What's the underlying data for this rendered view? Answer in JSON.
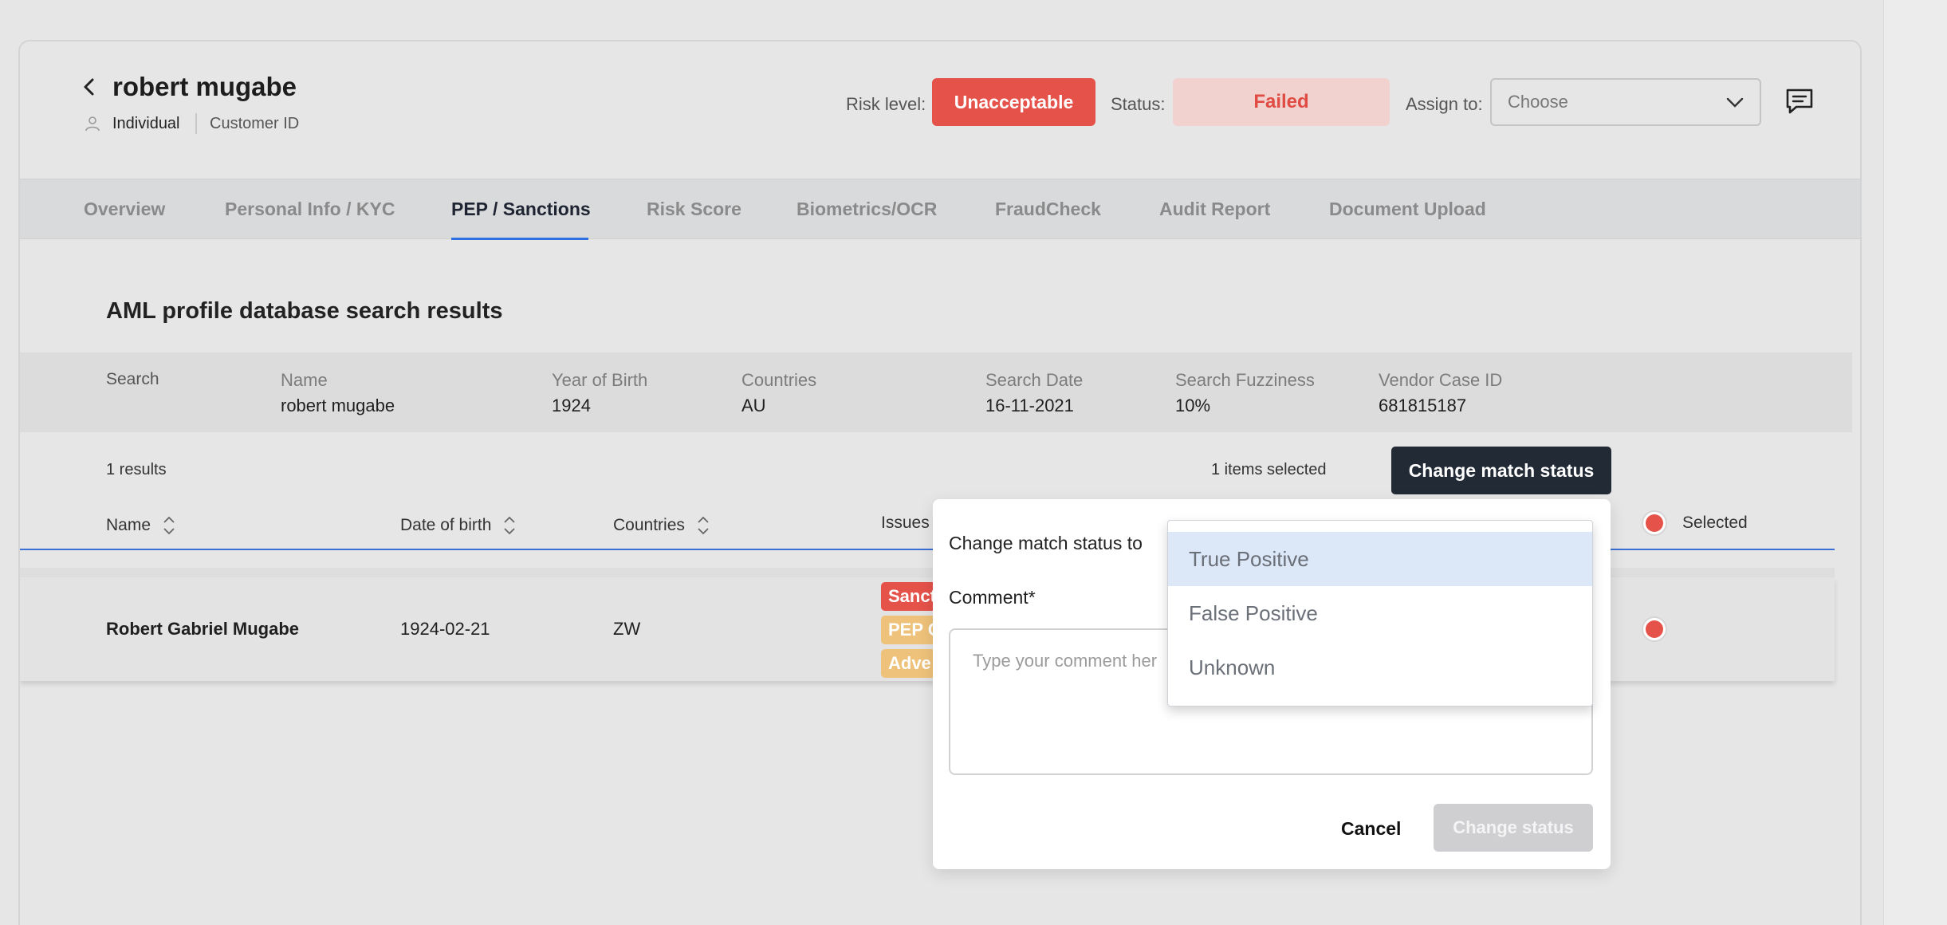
{
  "header": {
    "name": "robert mugabe",
    "entity_type": "Individual",
    "customer_id_label": "Customer ID",
    "risk_label": "Risk level:",
    "risk_value": "Unacceptable",
    "status_label": "Status:",
    "status_value": "Failed",
    "assign_label": "Assign to:",
    "assign_placeholder": "Choose",
    "colors": {
      "risk": "#e5524a",
      "status_bg": "#f1d2cf",
      "status_text": "#e04b43"
    }
  },
  "tabs": [
    {
      "label": "Overview"
    },
    {
      "label": "Personal Info / KYC"
    },
    {
      "label": "PEP / Sanctions",
      "active": true
    },
    {
      "label": "Risk Score"
    },
    {
      "label": "Biometrics/OCR"
    },
    {
      "label": "FraudCheck"
    },
    {
      "label": "Audit Report"
    },
    {
      "label": "Document Upload"
    }
  ],
  "section": {
    "title": "AML profile database search results",
    "search_label": "Search",
    "fields": [
      {
        "label": "Name",
        "value": "robert mugabe"
      },
      {
        "label": "Year of Birth",
        "value": "1924"
      },
      {
        "label": "Countries",
        "value": "AU"
      },
      {
        "label": "Search Date",
        "value": "16-11-2021"
      },
      {
        "label": "Search Fuzziness",
        "value": "10%"
      },
      {
        "label": "Vendor Case ID",
        "value": "681815187"
      }
    ],
    "results_count": "1 results",
    "items_selected": "1 items selected",
    "change_match_button": "Change match status"
  },
  "table": {
    "columns": [
      "Name",
      "Date of birth",
      "Countries",
      "Issues",
      "Selected"
    ],
    "rows": [
      {
        "name": "Robert Gabriel Mugabe",
        "dob": "1924-02-21",
        "country": "ZW",
        "issues": [
          "Sanct",
          "PEP C",
          "Adve"
        ]
      }
    ],
    "issue_colors": [
      "#e5524a",
      "#eec27a",
      "#eec27a"
    ]
  },
  "popover": {
    "label": "Change match status to",
    "comment_label": "Comment*",
    "comment_placeholder": "Type your comment her",
    "cancel": "Cancel",
    "submit": "Change status",
    "options": [
      "True Positive",
      "False Positive",
      "Unknown"
    ],
    "highlighted_option": "True Positive"
  }
}
